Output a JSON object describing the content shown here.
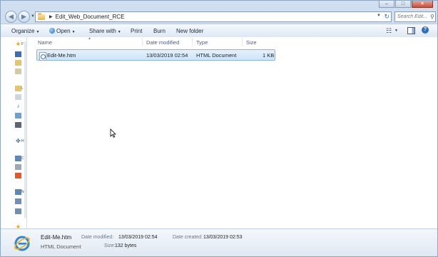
{
  "address": {
    "breadcrumb": "Edit_Web_Document_RCE",
    "search_placeholder": "Search Edit..."
  },
  "toolbar": {
    "organize": "Organize",
    "open": "Open",
    "share_with": "Share with",
    "print": "Print",
    "burn": "Burn",
    "new_folder": "New folder"
  },
  "columns": {
    "name": "Name",
    "date_modified": "Date modified",
    "type": "Type",
    "size": "Size"
  },
  "files": [
    {
      "name": "Edit-Me.htm",
      "date_modified": "13/03/2019 02:54",
      "type": "HTML Document",
      "size": "1 KB"
    }
  ],
  "details": {
    "name": "Edit-Me.htm",
    "type": "HTML Document",
    "date_modified_label": "Date modified:",
    "date_modified": "13/03/2019 02:54",
    "date_created_label": "Date created:",
    "date_created": "13/03/2019 02:53",
    "size_label": "Size:",
    "size": "132 bytes"
  },
  "colors": {
    "selection": "#cce4fa",
    "chrome": "#cfdff0",
    "toolbar": "#dde8f4"
  }
}
